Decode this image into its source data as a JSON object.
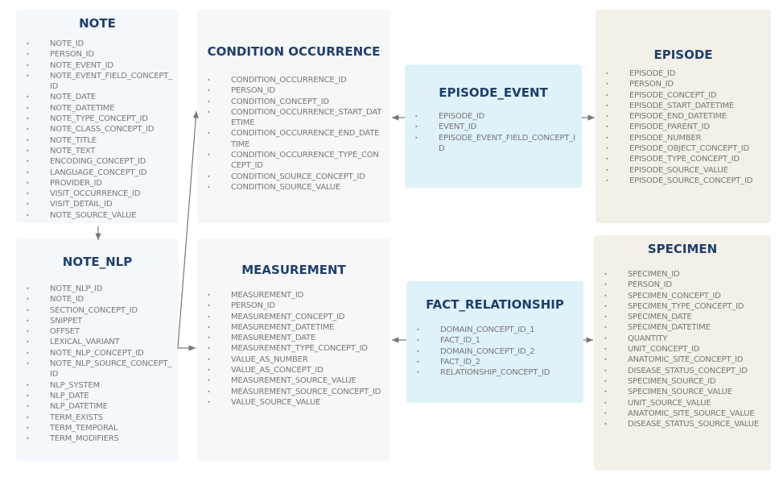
{
  "tables": {
    "note": {
      "title": "NOTE",
      "color": "#f4f8fd",
      "fields": [
        "NOTE_ID",
        "PERSON_ID",
        "NOTE_EVENT_ID",
        "NOTE_EVENT_FIELD_CONCEPT_ID",
        "NOTE_DATE",
        "NOTE_DATETIME",
        "NOTE_TYPE_CONCEPT_ID",
        "NOTE_CLASS_CONCEPT_ID",
        "NOTE_TITLE",
        "NOTE_TEXT",
        "ENCODING_CONCEPT_ID",
        "LANGUAGE_CONCEPT_ID",
        "PROVIDER_ID",
        "VISIT_OCCURRENCE_ID",
        "VISIT_DETAIL_ID",
        "NOTE_SOURCE_VALUE"
      ]
    },
    "condition": {
      "title": "CONDITION OCCURRENCE",
      "color": "#f7f7f7",
      "fields": [
        "CONDITION_OCCURRENCE_ID",
        "PERSON_ID",
        "CONDITION_CONCEPT_ID",
        "CONDITION_OCCURRENCE_START_DATETIME",
        "CONDITION_OCCURRENCE_END_DATETIME",
        "CONDITION_OCCURRENCE_TYPE_CONCEPT_ID",
        "CONDITION_SOURCE_CONCEPT_ID",
        "CONDITION_SOURCE_VALUE"
      ]
    },
    "episode_event": {
      "title": "EPISODE_EVENT",
      "color": "#dff1f9",
      "fields": [
        "EPISODE_ID",
        "EVENT_ID",
        "EPISODE_EVENT_FIELD_CONCEPT_ID"
      ]
    },
    "episode": {
      "title": "EPISODE",
      "color": "#f3f0e8",
      "fields": [
        "EPISODE_ID",
        "PERSON_ID",
        "EPISODE_CONCEPT_ID",
        "EPISODE_START_DATETIME",
        "EPISODE_END_DATETIME",
        "EPISODE_PARENT_ID",
        "EPISODE_NUMBER",
        "EPISODE_OBJECT_CONCEPT_ID",
        "EPISODE_TYPE_CONCEPT_ID",
        "EPISODE_SOURCE_VALUE",
        "EPISODE_SOURCE_CONCEPT_ID"
      ]
    },
    "note_nlp": {
      "title": "NOTE_NLP",
      "color": "#f4f8fd",
      "fields": [
        "NOTE_NLP_ID",
        "NOTE_ID",
        "SECTION_CONCEPT_ID",
        "SNIPPET",
        "OFFSET",
        "LEXICAL_VARIANT",
        "NOTE_NLP_CONCEPT_ID",
        "NOTE_NLP_SOURCE_CONCEPT_ID",
        "NLP_SYSTEM",
        "NLP_DATE",
        "NLP_DATETIME",
        "TERM_EXISTS",
        "TERM_TEMPORAL",
        "TERM_MODIFIERS"
      ]
    },
    "measurement": {
      "title": "MEASUREMENT",
      "color": "#f7f7f7",
      "fields": [
        "MEASUREMENT_ID",
        "PERSON_ID",
        "MEASUREMENT_CONCEPT_ID",
        "MEASUREMENT_DATETIME",
        "MEASUREMENT_DATE",
        "MEASUREMENT_TYPE_CONCEPT_ID",
        "VALUE_AS_NUMBER",
        "VALUE_AS_CONCEPT_ID",
        "MEASUREMENT_SOURCE_VALUE",
        "MEASUREMENT_SOURCE_CONCEPT_ID",
        "VALUE_SOURCE_VALUE"
      ]
    },
    "fact_relationship": {
      "title": "FACT_RELATIONSHIP",
      "color": "#dff1f9",
      "fields": [
        "DOMAIN_CONCEPT_ID_1",
        "FACT_ID_1",
        "DOMAIN_CONCEPT_ID_2",
        "FACT_ID_2",
        "RELATIONSHIP_CONCEPT_ID"
      ]
    },
    "specimen": {
      "title": "SPECIMEN",
      "color": "#f3f0e8",
      "fields": [
        "SPECIMEN_ID",
        "PERSON_ID",
        "SPECIMEN_CONCEPT_ID",
        "SPECIMEN_TYPE_CONCEPT_ID",
        "SPECIMEN_DATE",
        "SPECIMEN_DATETIME",
        "QUANTITY",
        "UNIT_CONCEPT_ID",
        "ANATOMIC_SITE_CONCEPT_ID",
        "DISEASE_STATUS_CONCEPT_ID",
        "SPECIMEN_SOURCE_ID",
        "SPECIMEN_SOURCE_VALUE",
        "UNIT_SOURCE_VALUE",
        "ANATOMIC_SITE_SOURCE_VALUE",
        "DISEASE_STATUS_SOURCE_VALUE"
      ]
    }
  },
  "colors": {
    "title": "#1f3e6e",
    "text": "#777777",
    "arrow": "#777777"
  }
}
